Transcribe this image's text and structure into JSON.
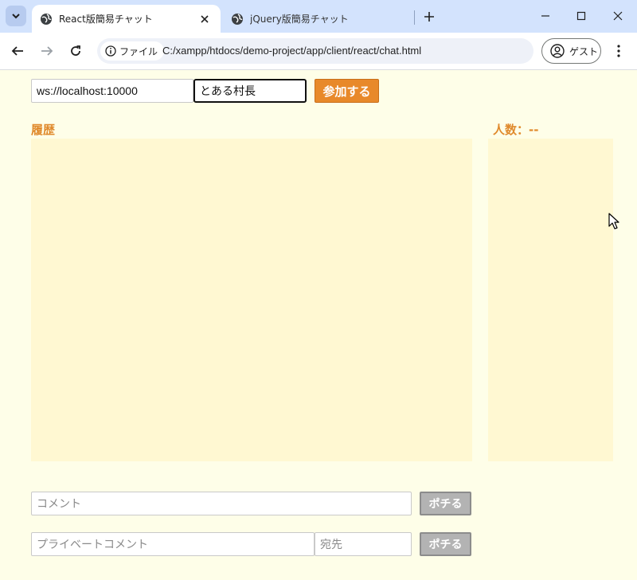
{
  "browser": {
    "tabs": [
      {
        "title": "React版簡易チャット",
        "active": true
      },
      {
        "title": "jQuery版簡易チャット",
        "active": false
      }
    ],
    "site_chip": "ファイル",
    "url": "C:/xampp/htdocs/demo-project/app/client/react/chat.html",
    "profile_label": "ゲスト"
  },
  "connect": {
    "ws_url_value": "ws://localhost:10000",
    "username_value": "とある村長",
    "join_label": "参加する"
  },
  "history": {
    "label": "履歴"
  },
  "members": {
    "label": "人数：--"
  },
  "comment": {
    "placeholder": "コメント",
    "send_label": "ポチる"
  },
  "private_comment": {
    "placeholder": "プライベートコメント",
    "dest_placeholder": "宛先",
    "send_label": "ポチる"
  },
  "colors": {
    "page_bg": "#fefee8",
    "panel_bg": "#fff8d2",
    "accent": "#e8892a",
    "label": "#e08a2c",
    "disabled_button": "#b3b3b3",
    "tabstrip": "#d3e3fd"
  }
}
